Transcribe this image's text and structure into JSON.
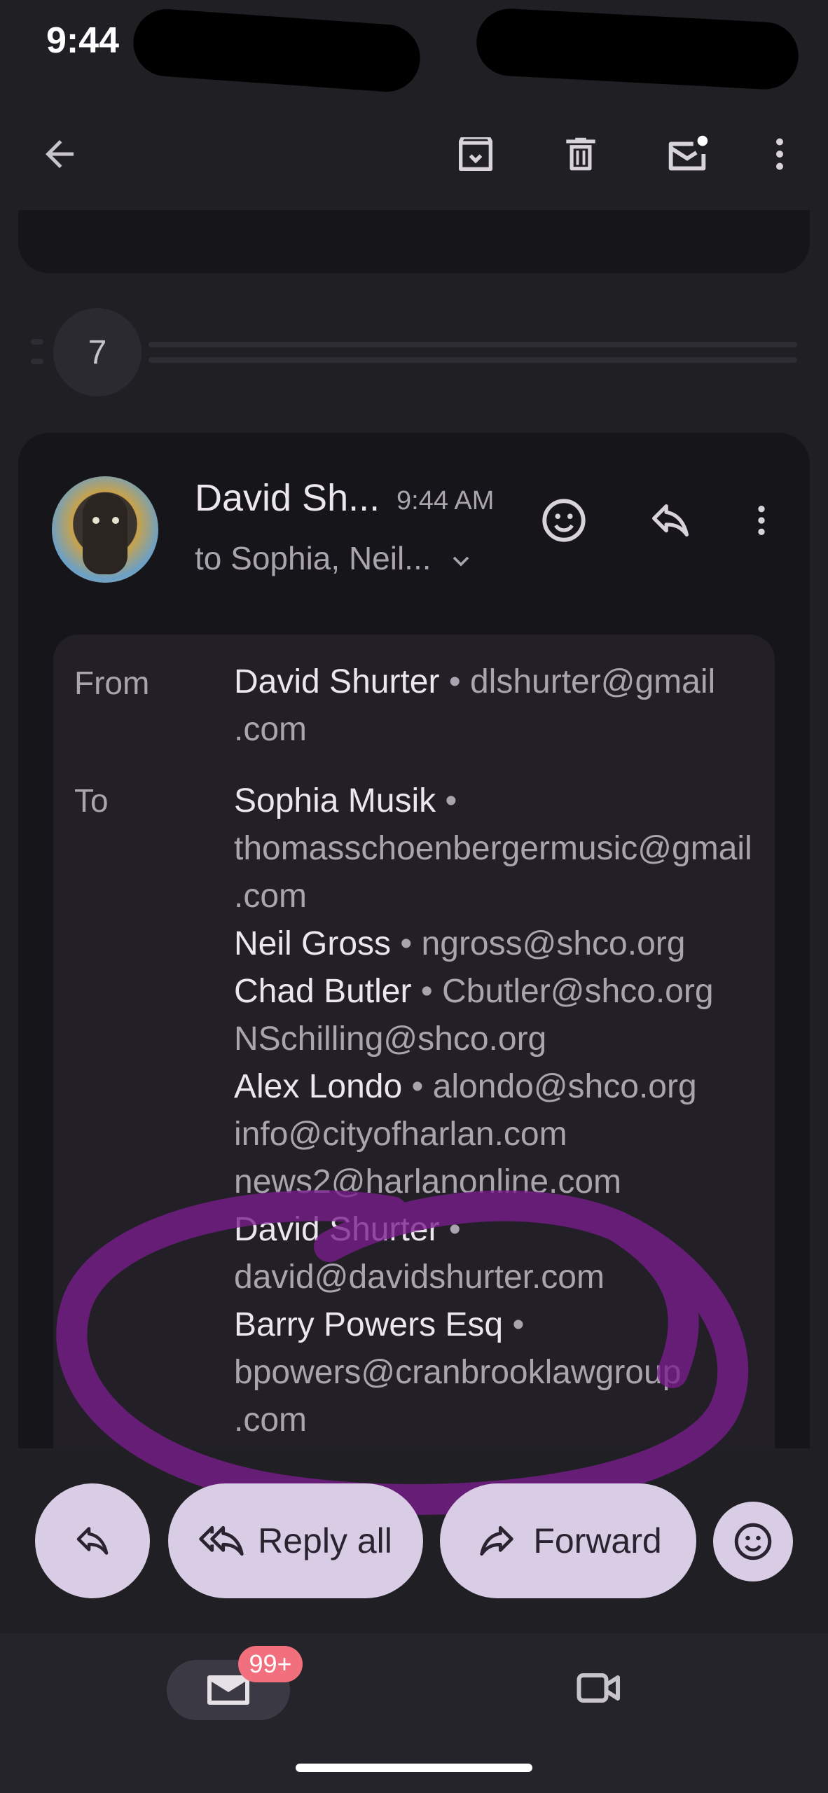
{
  "status_bar": {
    "time": "9:44"
  },
  "toolbar": {
    "back_icon": "arrow-back-icon",
    "archive_icon": "archive-icon",
    "delete_icon": "trash-icon",
    "mark_unread_icon": "mail-unread-icon",
    "more_icon": "more-vert-icon"
  },
  "thread": {
    "collapsed_count": "7"
  },
  "message": {
    "sender_short": "David Sh...",
    "time": "9:44 AM",
    "to_summary": "to Sophia, Neil...",
    "from_label": "From",
    "to_label": "To",
    "from_name": "David Shurter",
    "from_email_1": "dlshurter@gmail",
    "from_email_2": ".com",
    "recipients": {
      "r1_name": "Sophia Musik",
      "r1_email_1": "thomasschoenbergermusic@gmail",
      "r1_email_2": ".com",
      "r2_name": "Neil Gross",
      "r2_email": "ngross@shco.org",
      "r3_name": "Chad Butler",
      "r3_email": "Cbutler@shco.org",
      "r4_email": "NSchilling@shco.org",
      "r5_name": "Alex Londo",
      "r5_email": "alondo@shco.org",
      "r6_email": "info@cityofharlan.com",
      "r7_email": "news2@harlanonline.com",
      "r8_name": "David Shurter",
      "r8_email": "david@davidshurter.com",
      "r9_name": "Barry Powers Esq",
      "r9_email_1": "bpowers@cranbrooklawgroup",
      "r9_email_2": ".com"
    },
    "separator": "•"
  },
  "actions": {
    "reply_all": "Reply all",
    "forward": "Forward"
  },
  "bottom_nav": {
    "badge": "99+"
  },
  "colors": {
    "annotation": "#7a1e8c",
    "pill": "#d9cde6",
    "badge": "#f2707e"
  }
}
